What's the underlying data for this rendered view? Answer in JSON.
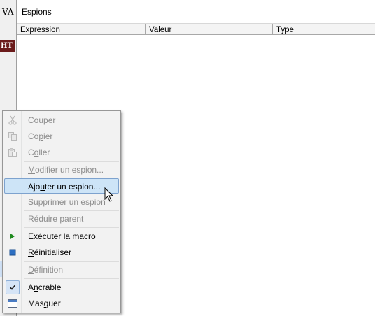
{
  "background": {
    "left_text": "VA",
    "tag_text": "HT"
  },
  "watch": {
    "title": "Espions",
    "columns": [
      "Expression",
      "Valeur",
      "Type"
    ]
  },
  "context_menu": {
    "items": [
      {
        "label": "Couper",
        "mnemonic": "C",
        "enabled": false,
        "icon": "scissors-icon"
      },
      {
        "label": "Copier",
        "mnemonic": "p",
        "enabled": false,
        "icon": "copy-icon"
      },
      {
        "label": "Coller",
        "mnemonic": "o",
        "enabled": false,
        "icon": "paste-icon"
      },
      {
        "label": "Modifier un espion...",
        "mnemonic": "M",
        "enabled": false
      },
      {
        "label": "Ajouter un espion...",
        "mnemonic": "u",
        "enabled": true,
        "hovered": true
      },
      {
        "label": "Supprimer un espion",
        "mnemonic": "S",
        "enabled": false
      },
      {
        "label": "Réduire parent",
        "enabled": false
      },
      {
        "label": "Exécuter la macro",
        "enabled": true,
        "icon": "run-macro-icon"
      },
      {
        "label": "Réinitialiser",
        "mnemonic": "R",
        "enabled": true,
        "icon": "reset-icon"
      },
      {
        "label": "Définition",
        "mnemonic": "D",
        "enabled": false
      },
      {
        "label": "Ancrable",
        "mnemonic": "n",
        "enabled": true,
        "checked": true,
        "icon": "checkmark-icon"
      },
      {
        "label": "Masquer",
        "mnemonic": "q",
        "enabled": true,
        "icon": "hide-window-icon"
      }
    ]
  },
  "colors": {
    "hover_fill": "#cde4f7",
    "hover_border": "#7da2ce",
    "disabled_text": "#8d8d8d",
    "run_green": "#1f8a1f",
    "reset_blue": "#2d6fc2",
    "tag_bg": "#6b1b1b"
  }
}
